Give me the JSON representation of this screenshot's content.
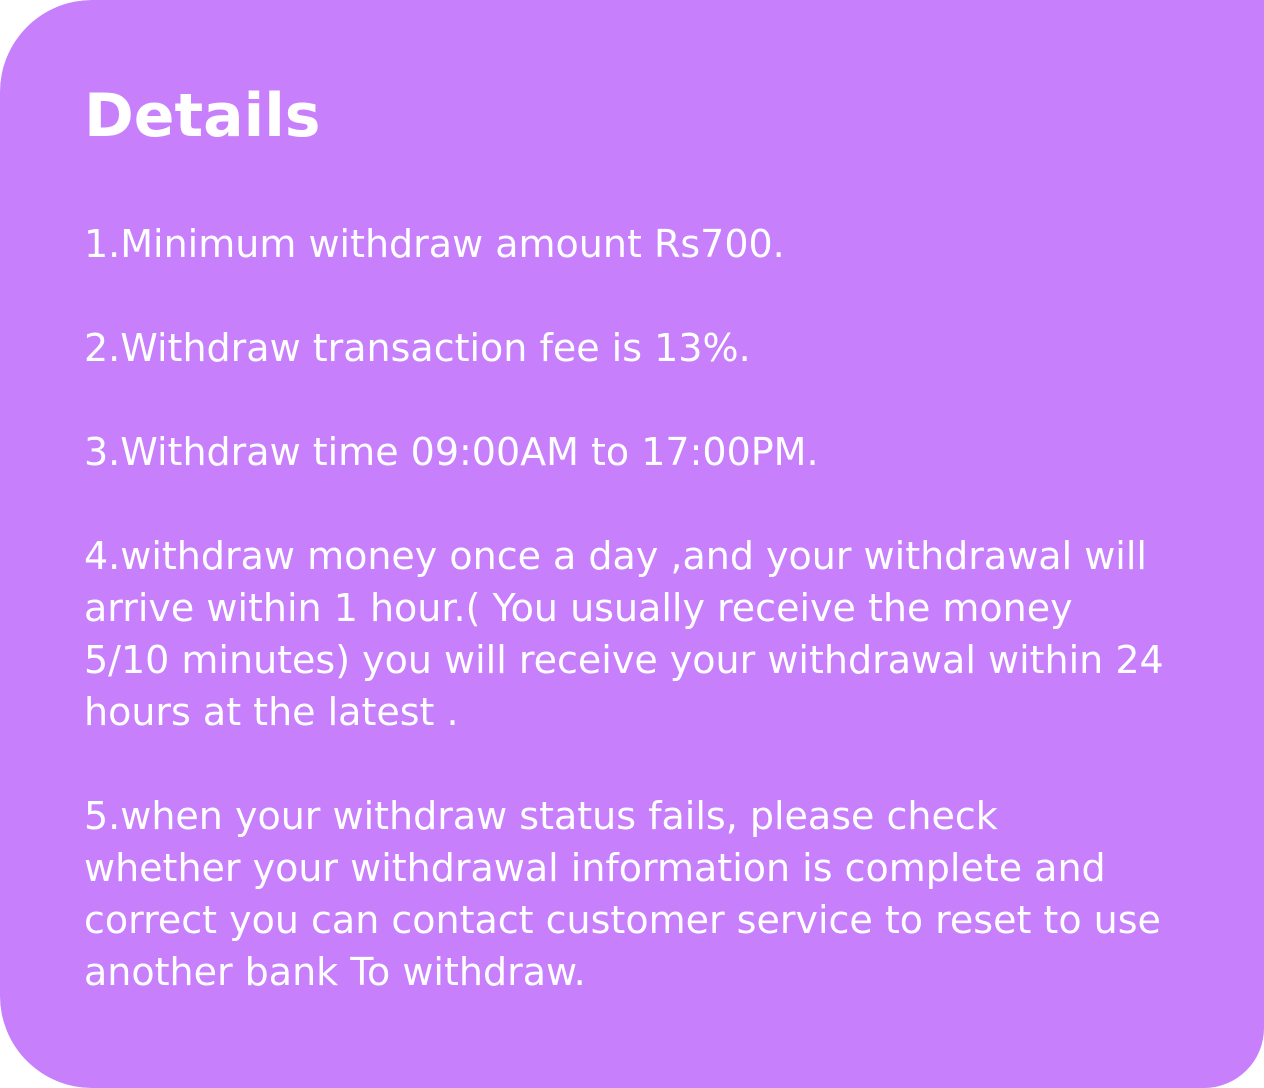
{
  "panel": {
    "title": "Details",
    "items": [
      "1.Minimum withdraw amount Rs700.",
      "2.Withdraw transaction fee is 13%.",
      "3.Withdraw time 09:00AM to 17:00PM.",
      "4.withdraw money once a day ,and your withdrawal will arrive within 1 hour.( You usually receive the money 5/10  minutes)  you will receive your withdrawal within 24 hours at the latest .",
      "5.when your withdraw status fails, please check whether your withdrawal information is complete and correct you can contact  customer service to reset to use another bank To withdraw."
    ],
    "colors": {
      "background": "#c77ffc",
      "text": "#ffffff"
    }
  }
}
